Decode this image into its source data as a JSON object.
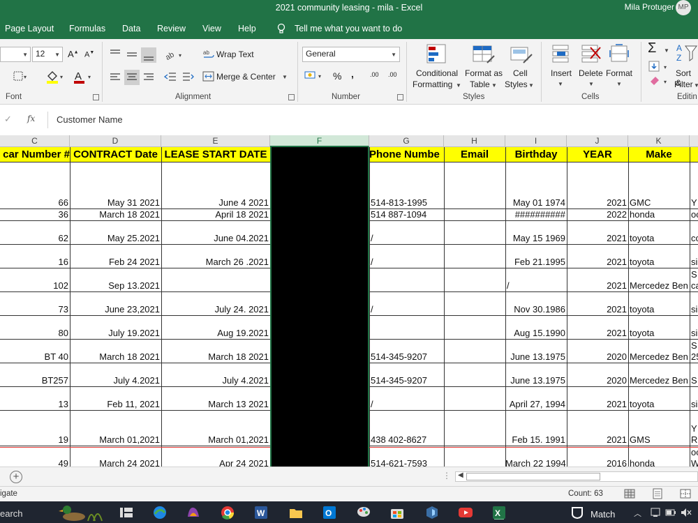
{
  "window": {
    "title": "2021 community leasing - mila  -  Excel",
    "user": "Mila Protuger",
    "avatar_initials": "MP"
  },
  "tabs": [
    "Page Layout",
    "Formulas",
    "Data",
    "Review",
    "View",
    "Help"
  ],
  "tell_me": "Tell me what you want to do",
  "ribbon": {
    "font_size": "12",
    "wrap_text": "Wrap Text",
    "merge_center": "Merge & Center",
    "number_format": "General",
    "conditional_formatting": [
      "Conditional",
      "Formatting"
    ],
    "format_as_table": [
      "Format as",
      "Table"
    ],
    "cell_styles": [
      "Cell",
      "Styles"
    ],
    "insert": "Insert",
    "delete": "Delete",
    "format": "Format",
    "sort_filter": [
      "Sort &",
      "Filter"
    ],
    "groups": {
      "font": "Font",
      "alignment": "Alignment",
      "number": "Number",
      "styles": "Styles",
      "cells": "Cells",
      "editing": "Editin"
    },
    "percent": "%",
    "comma": ",",
    "dec_inc": ".00",
    "dec_dec": ".00"
  },
  "formula_bar": {
    "fx": "fx",
    "content": "Customer Name"
  },
  "columns": [
    "C",
    "D",
    "E",
    "F",
    "G",
    "H",
    "I",
    "J",
    "K"
  ],
  "header_row": {
    "C": "car Number #",
    "D": "CONTRACT Date",
    "E": "LEASE START DATE",
    "F": "",
    "G": "Phone Numbe",
    "H": "Email",
    "I": "Birthday",
    "J": "YEAR",
    "K": "Make"
  },
  "rows": [
    {
      "C": "66",
      "D": "May 31 2021",
      "E": "June 4 2021",
      "G": "514-813-1995",
      "H": "",
      "I": "May 01 1974",
      "J": "2021",
      "K": "GMC",
      "L": "Y"
    },
    {
      "C": "36",
      "D": "March 18 2021",
      "E": "April 18 2021",
      "G": "514 887-1094",
      "H": "",
      "I": "##########",
      "J": "2022",
      "K": "honda",
      "L": "oc"
    },
    {
      "C": "62",
      "D": "May 25.2021",
      "E": "June 04.2021",
      "G": "/",
      "H": "",
      "I": "May 15 1969",
      "J": "2021",
      "K": "toyota",
      "L": "co"
    },
    {
      "C": "16",
      "D": "Feb 24 2021",
      "E": "March 26 .2021",
      "G": "/",
      "H": "",
      "I": "Feb 21.1995",
      "J": "2021",
      "K": "toyota",
      "L": "si"
    },
    {
      "C": "102",
      "D": "Sep 13.2021",
      "E": "",
      "G": "",
      "H": "",
      "I": "/",
      "J": "2021",
      "K": "Mercedez Ben",
      "L": "S",
      "L2": "ca"
    },
    {
      "C": "73",
      "D": "June 23,2021",
      "E": "July 24. 2021",
      "G": "/",
      "H": "",
      "I": "Nov 30.1986",
      "J": "2021",
      "K": "toyota",
      "L": "si"
    },
    {
      "C": "80",
      "D": "July 19.2021",
      "E": "Aug 19.2021",
      "G": "",
      "H": "",
      "I": "Aug 15.1990",
      "J": "2021",
      "K": "toyota",
      "L": "si"
    },
    {
      "C": "BT 40",
      "D": "March 18 2021",
      "E": "March 18 2021",
      "G": "514-345-9207",
      "H": "",
      "I": "June 13.1975",
      "J": "2020",
      "K": "Mercedez Ben",
      "L": "S",
      "L2": "25"
    },
    {
      "C": "BT257",
      "D": "July 4.2021",
      "E": "July 4.2021",
      "G": "514-345-9207",
      "H": "",
      "I": "June 13.1975",
      "J": "2020",
      "K": "Mercedez Ben",
      "L": "S"
    },
    {
      "C": "13",
      "D": "Feb 11, 2021",
      "E": "March 13 2021",
      "G": "/",
      "H": "",
      "I": "April 27, 1994",
      "J": "2021",
      "K": "toyota",
      "L": "si"
    },
    {
      "C": "19",
      "D": "March 01,2021",
      "E": "March 01,2021",
      "G": "438 402-8627",
      "H": "",
      "I": "Feb 15. 1991",
      "J": "2021",
      "K": "GMS",
      "L": "Y",
      "L2": "R"
    },
    {
      "C": "49",
      "D": "March 24 2021",
      "E": "Apr 24 2021",
      "G": "514-621-7593",
      "H": "",
      "I": "March 22 1994",
      "J": "2016",
      "K": "honda",
      "L": "oc",
      "L2": "W"
    }
  ],
  "sheetbar": {
    "add": "+",
    "dots": "⋮"
  },
  "status": {
    "left": "igate",
    "count": "Count: 63"
  },
  "taskbar": {
    "search": "earch",
    "match": "Match"
  }
}
